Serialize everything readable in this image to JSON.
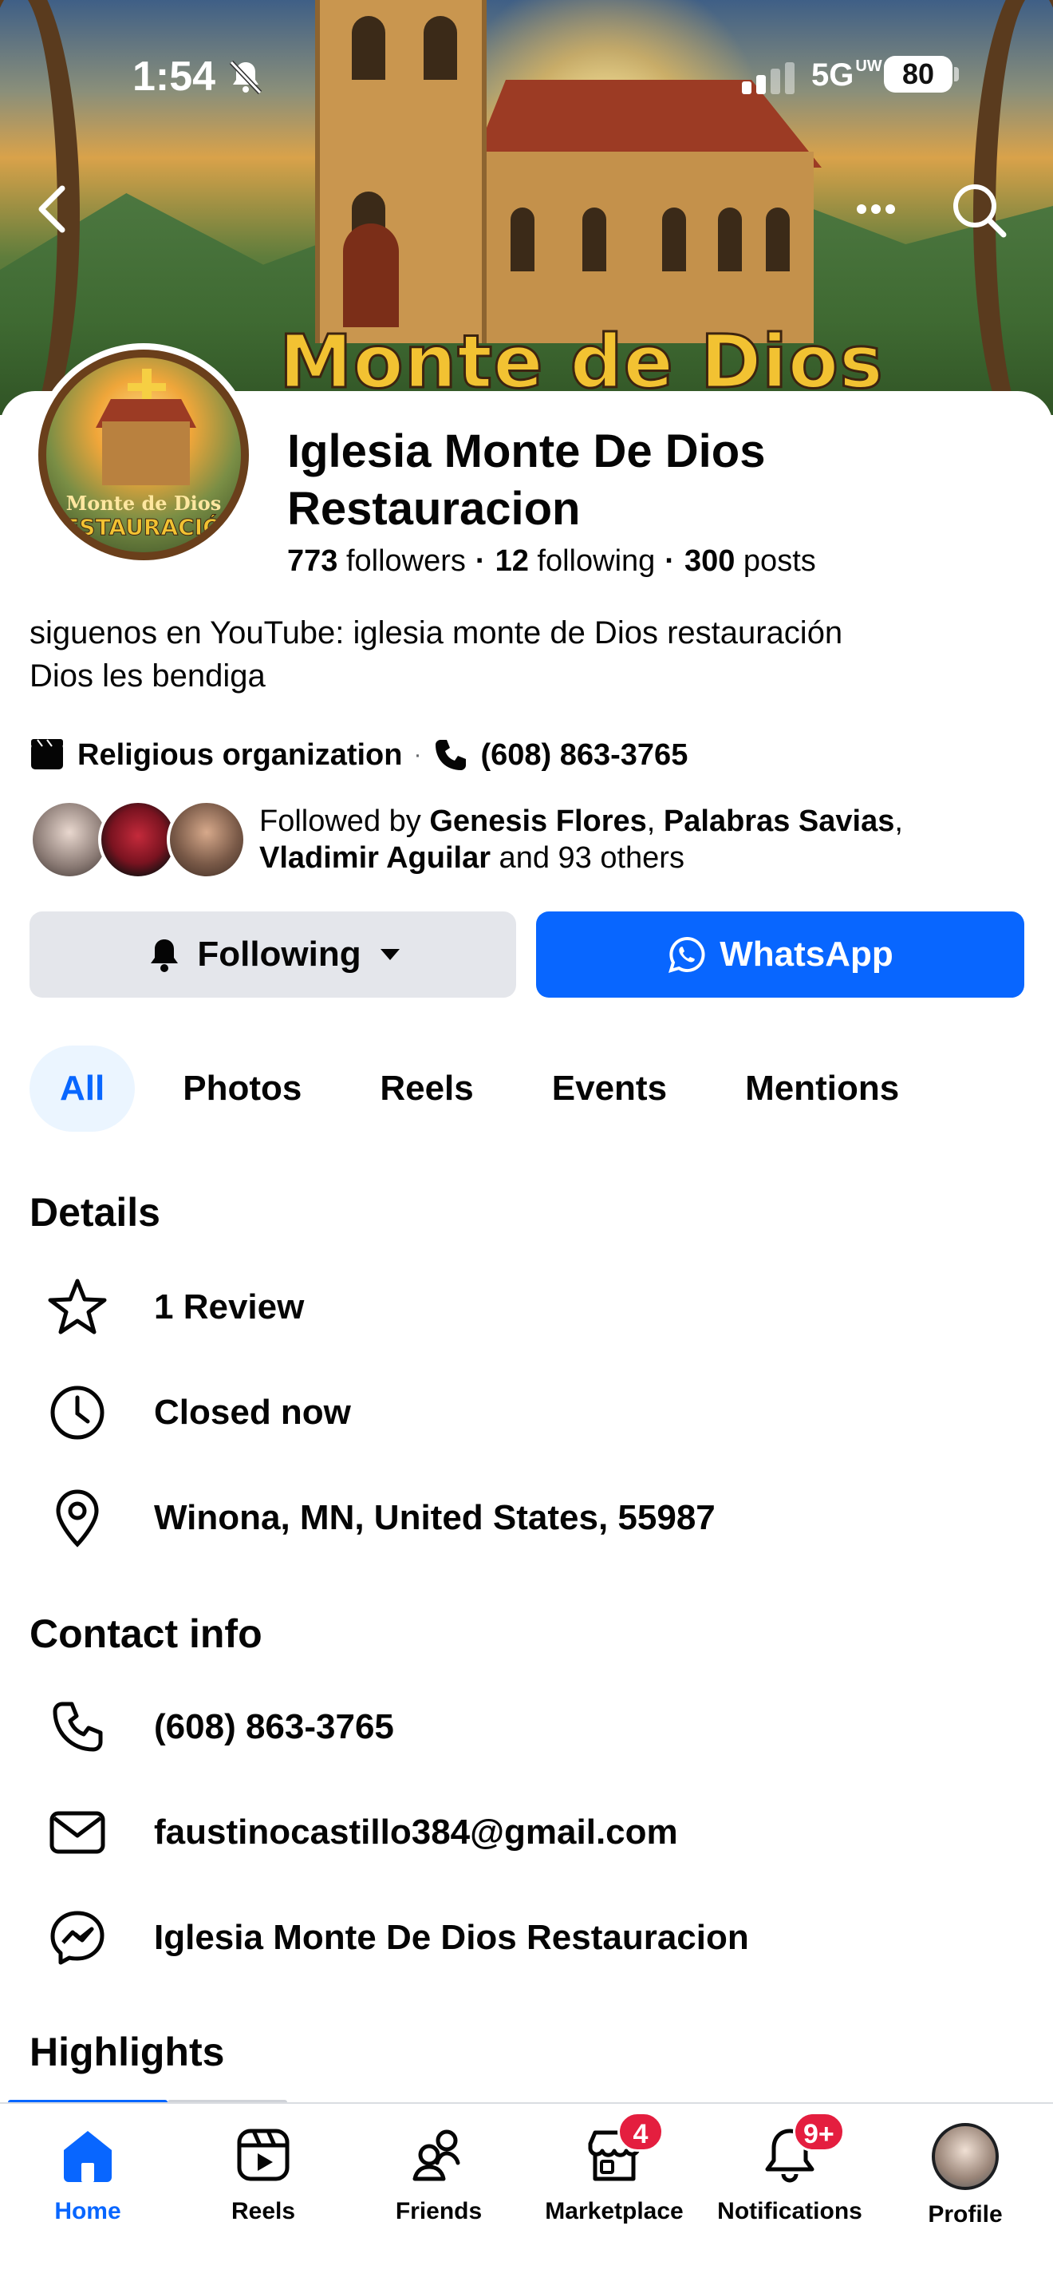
{
  "status_bar": {
    "time": "1:54",
    "network": "5G",
    "network_sup": "UW",
    "battery": "80"
  },
  "cover": {
    "title": "Monte de Dios"
  },
  "avatar": {
    "line1": "Monte de Dios",
    "line2": "RESTAURACIÓN"
  },
  "page": {
    "name": "Iglesia Monte De Dios Restauracion",
    "followers_count": "773",
    "followers_label": "followers",
    "following_count": "12",
    "following_label": "following",
    "posts_count": "300",
    "posts_label": "posts",
    "bio_line1": "siguenos en YouTube: iglesia monte de Dios restauración",
    "bio_line2": "Dios les bendiga",
    "category": "Religious organization",
    "phone": "(608) 863-3765",
    "followed_by_prefix": "Followed by ",
    "followed_by_1": "Genesis Flores",
    "followed_by_2": "Palabras Savias",
    "followed_by_3": "Vladimir Aguilar",
    "followed_by_suffix": " and 93 others"
  },
  "actions": {
    "following_label": "Following",
    "whatsapp_label": "WhatsApp",
    "whatsapp_color": "#0866ff"
  },
  "tabs": [
    {
      "label": "All",
      "active": true
    },
    {
      "label": "Photos"
    },
    {
      "label": "Reels"
    },
    {
      "label": "Events"
    },
    {
      "label": "Mentions"
    }
  ],
  "details": {
    "title": "Details",
    "review": "1 Review",
    "hours": "Closed now",
    "location": "Winona, MN, United States, 55987"
  },
  "contact": {
    "title": "Contact info",
    "phone": "(608) 863-3765",
    "email": "faustinocastillo384@gmail.com",
    "messenger": "Iglesia Monte De Dios Restauracion"
  },
  "highlights": {
    "title": "Highlights"
  },
  "bottom_nav": {
    "home": "Home",
    "reels": "Reels",
    "friends": "Friends",
    "marketplace": "Marketplace",
    "marketplace_badge": "4",
    "notifications": "Notifications",
    "notifications_badge": "9+",
    "profile": "Profile"
  },
  "colors": {
    "accent": "#0866ff",
    "badge": "#e41e3f",
    "text": "#050505"
  }
}
